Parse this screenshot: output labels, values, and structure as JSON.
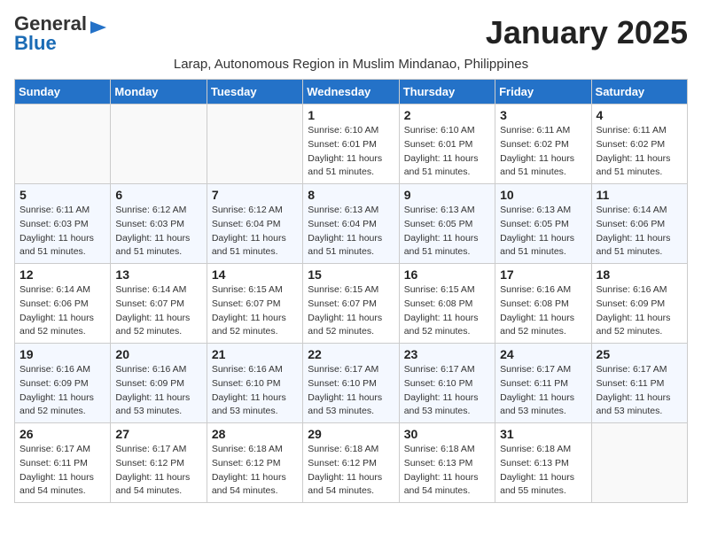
{
  "header": {
    "logo_general": "General",
    "logo_blue": "Blue",
    "month_title": "January 2025",
    "subtitle": "Larap, Autonomous Region in Muslim Mindanao, Philippines"
  },
  "days_of_week": [
    "Sunday",
    "Monday",
    "Tuesday",
    "Wednesday",
    "Thursday",
    "Friday",
    "Saturday"
  ],
  "weeks": [
    [
      {
        "day": "",
        "info": ""
      },
      {
        "day": "",
        "info": ""
      },
      {
        "day": "",
        "info": ""
      },
      {
        "day": "1",
        "info": "Sunrise: 6:10 AM\nSunset: 6:01 PM\nDaylight: 11 hours\nand 51 minutes."
      },
      {
        "day": "2",
        "info": "Sunrise: 6:10 AM\nSunset: 6:01 PM\nDaylight: 11 hours\nand 51 minutes."
      },
      {
        "day": "3",
        "info": "Sunrise: 6:11 AM\nSunset: 6:02 PM\nDaylight: 11 hours\nand 51 minutes."
      },
      {
        "day": "4",
        "info": "Sunrise: 6:11 AM\nSunset: 6:02 PM\nDaylight: 11 hours\nand 51 minutes."
      }
    ],
    [
      {
        "day": "5",
        "info": "Sunrise: 6:11 AM\nSunset: 6:03 PM\nDaylight: 11 hours\nand 51 minutes."
      },
      {
        "day": "6",
        "info": "Sunrise: 6:12 AM\nSunset: 6:03 PM\nDaylight: 11 hours\nand 51 minutes."
      },
      {
        "day": "7",
        "info": "Sunrise: 6:12 AM\nSunset: 6:04 PM\nDaylight: 11 hours\nand 51 minutes."
      },
      {
        "day": "8",
        "info": "Sunrise: 6:13 AM\nSunset: 6:04 PM\nDaylight: 11 hours\nand 51 minutes."
      },
      {
        "day": "9",
        "info": "Sunrise: 6:13 AM\nSunset: 6:05 PM\nDaylight: 11 hours\nand 51 minutes."
      },
      {
        "day": "10",
        "info": "Sunrise: 6:13 AM\nSunset: 6:05 PM\nDaylight: 11 hours\nand 51 minutes."
      },
      {
        "day": "11",
        "info": "Sunrise: 6:14 AM\nSunset: 6:06 PM\nDaylight: 11 hours\nand 51 minutes."
      }
    ],
    [
      {
        "day": "12",
        "info": "Sunrise: 6:14 AM\nSunset: 6:06 PM\nDaylight: 11 hours\nand 52 minutes."
      },
      {
        "day": "13",
        "info": "Sunrise: 6:14 AM\nSunset: 6:07 PM\nDaylight: 11 hours\nand 52 minutes."
      },
      {
        "day": "14",
        "info": "Sunrise: 6:15 AM\nSunset: 6:07 PM\nDaylight: 11 hours\nand 52 minutes."
      },
      {
        "day": "15",
        "info": "Sunrise: 6:15 AM\nSunset: 6:07 PM\nDaylight: 11 hours\nand 52 minutes."
      },
      {
        "day": "16",
        "info": "Sunrise: 6:15 AM\nSunset: 6:08 PM\nDaylight: 11 hours\nand 52 minutes."
      },
      {
        "day": "17",
        "info": "Sunrise: 6:16 AM\nSunset: 6:08 PM\nDaylight: 11 hours\nand 52 minutes."
      },
      {
        "day": "18",
        "info": "Sunrise: 6:16 AM\nSunset: 6:09 PM\nDaylight: 11 hours\nand 52 minutes."
      }
    ],
    [
      {
        "day": "19",
        "info": "Sunrise: 6:16 AM\nSunset: 6:09 PM\nDaylight: 11 hours\nand 52 minutes."
      },
      {
        "day": "20",
        "info": "Sunrise: 6:16 AM\nSunset: 6:09 PM\nDaylight: 11 hours\nand 53 minutes."
      },
      {
        "day": "21",
        "info": "Sunrise: 6:16 AM\nSunset: 6:10 PM\nDaylight: 11 hours\nand 53 minutes."
      },
      {
        "day": "22",
        "info": "Sunrise: 6:17 AM\nSunset: 6:10 PM\nDaylight: 11 hours\nand 53 minutes."
      },
      {
        "day": "23",
        "info": "Sunrise: 6:17 AM\nSunset: 6:10 PM\nDaylight: 11 hours\nand 53 minutes."
      },
      {
        "day": "24",
        "info": "Sunrise: 6:17 AM\nSunset: 6:11 PM\nDaylight: 11 hours\nand 53 minutes."
      },
      {
        "day": "25",
        "info": "Sunrise: 6:17 AM\nSunset: 6:11 PM\nDaylight: 11 hours\nand 53 minutes."
      }
    ],
    [
      {
        "day": "26",
        "info": "Sunrise: 6:17 AM\nSunset: 6:11 PM\nDaylight: 11 hours\nand 54 minutes."
      },
      {
        "day": "27",
        "info": "Sunrise: 6:17 AM\nSunset: 6:12 PM\nDaylight: 11 hours\nand 54 minutes."
      },
      {
        "day": "28",
        "info": "Sunrise: 6:18 AM\nSunset: 6:12 PM\nDaylight: 11 hours\nand 54 minutes."
      },
      {
        "day": "29",
        "info": "Sunrise: 6:18 AM\nSunset: 6:12 PM\nDaylight: 11 hours\nand 54 minutes."
      },
      {
        "day": "30",
        "info": "Sunrise: 6:18 AM\nSunset: 6:13 PM\nDaylight: 11 hours\nand 54 minutes."
      },
      {
        "day": "31",
        "info": "Sunrise: 6:18 AM\nSunset: 6:13 PM\nDaylight: 11 hours\nand 55 minutes."
      },
      {
        "day": "",
        "info": ""
      }
    ]
  ]
}
